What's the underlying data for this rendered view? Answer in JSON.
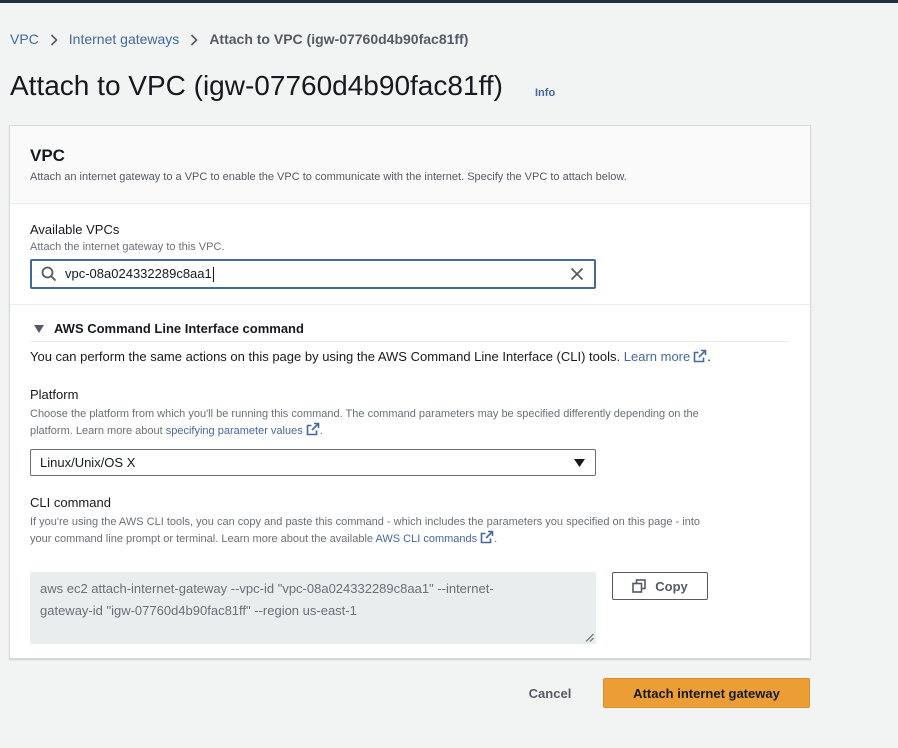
{
  "breadcrumb": {
    "items": [
      "VPC",
      "Internet gateways"
    ],
    "current": "Attach to VPC (igw-07760d4b90fac81ff)"
  },
  "page": {
    "title": "Attach to VPC (igw-07760d4b90fac81ff)",
    "info_label": "Info"
  },
  "vpc_section": {
    "title": "VPC",
    "description": "Attach an internet gateway to a VPC to enable the VPC to communicate with the internet. Specify the VPC to attach below."
  },
  "available_vpcs": {
    "label": "Available VPCs",
    "description": "Attach the internet gateway to this VPC.",
    "value": "vpc-08a024332289c8aa1"
  },
  "cli_section": {
    "title": "AWS Command Line Interface command",
    "intro": "You can perform the same actions on this page by using the AWS Command Line Interface (CLI) tools.",
    "learn_more": "Learn more",
    "platform": {
      "label": "Platform",
      "description_line1": "Choose the platform from which you'll be running this command. The command parameters may be specified differently depending on the",
      "description_line2": "platform. Learn more about",
      "description_link": "specifying parameter values",
      "selected": "Linux/Unix/OS X"
    },
    "cli_command": {
      "label": "CLI command",
      "description_line1": "If you're using the AWS CLI tools, you can copy and paste this command - which includes the parameters you specified on this page - into",
      "description_line2": "your command line prompt or terminal. Learn more about the available",
      "description_link": "AWS CLI commands",
      "code_line1": "aws ec2 attach-internet-gateway --vpc-id \"vpc-08a024332289c8aa1\" --internet-",
      "code_line2": "gateway-id \"igw-07760d4b90fac81ff\" --region us-east-1",
      "copy_label": "Copy"
    }
  },
  "footer": {
    "cancel_label": "Cancel",
    "submit_label": "Attach internet gateway"
  },
  "colors": {
    "link": "#44689c",
    "primary_button": "#ec9e36",
    "page_background": "#f2f3f3"
  }
}
